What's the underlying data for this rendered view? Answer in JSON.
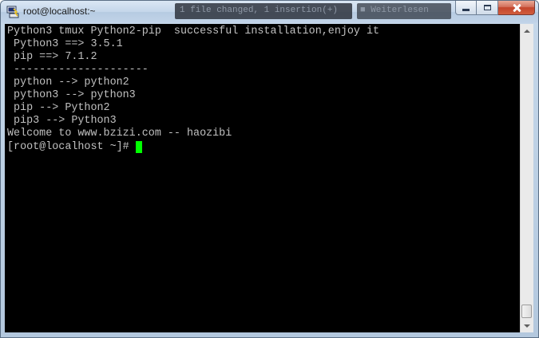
{
  "window": {
    "title": "root@localhost:~",
    "background_titles": [
      "1 file changed, 1 insertion(+)",
      "■ Weiterlesen"
    ]
  },
  "colors": {
    "terminal_bg": "#000000",
    "terminal_fg": "#c0c0c0",
    "cursor": "#00ff00",
    "close_button": "#c3452c"
  },
  "icons": {
    "app": "putty-icon",
    "minimize": "minimize-icon",
    "maximize": "maximize-icon",
    "close": "close-icon"
  },
  "terminal": {
    "lines": [
      "Python3 tmux Python2-pip  successful installation,enjoy it",
      " Python3 ==> 3.5.1",
      " pip ==> 7.1.2",
      " ---------------------",
      " python --> python2",
      " python3 --> python3",
      " pip --> Python2",
      " pip3 --> Python3",
      "Welcome to www.bzizi.com -- haozibi"
    ],
    "prompt": "[root@localhost ~]# "
  }
}
